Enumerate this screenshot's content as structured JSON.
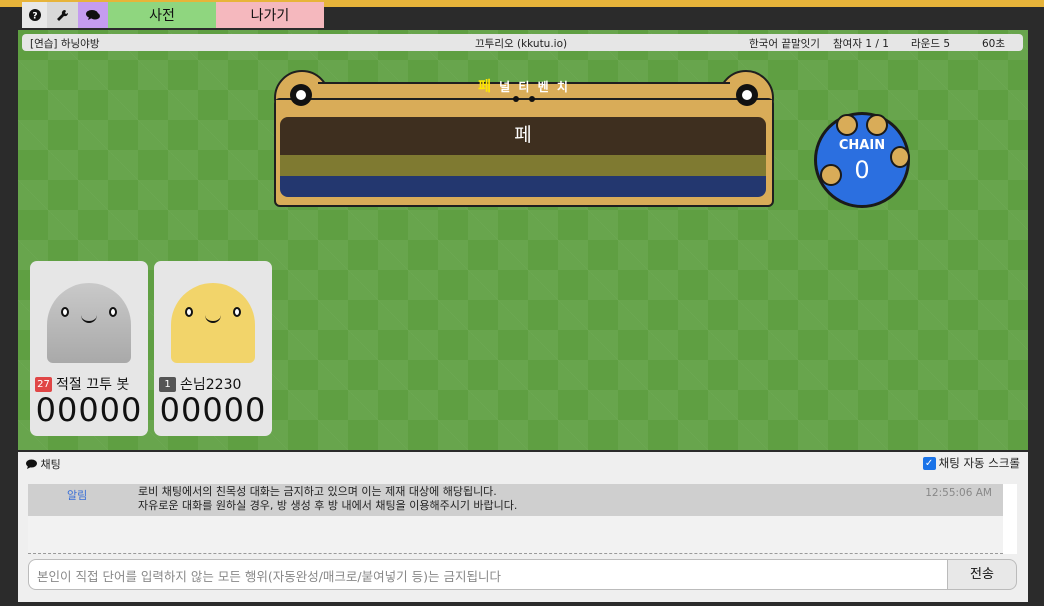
{
  "menu": {
    "dictionary_label": "사전",
    "exit_label": "나가기"
  },
  "room": {
    "name": "[연습] 하닝야방",
    "server": "끄투리오 (kkutu.io)",
    "mode": "한국어 끝말잇기",
    "participants": "참여자 1 / 1",
    "round": "라운드 5",
    "time": "60초"
  },
  "game": {
    "hint_first": "페",
    "hint_rest": " 널 티 벤 치",
    "current_word": "페",
    "chain_label": "CHAIN",
    "chain_value": "0"
  },
  "players": [
    {
      "level": "27",
      "name": "적절 끄투 봇",
      "score": "00000",
      "level_color": "#e04646"
    },
    {
      "level": "1",
      "name": "손님2230",
      "score": "00000",
      "level_color": "#555555"
    }
  ],
  "chat": {
    "title": "채팅",
    "autoscroll_label": "채팅 자동 스크롤",
    "autoscroll_checked": true,
    "messages": [
      {
        "sender": "알림",
        "line1": "로비 채팅에서의 친목성 대화는 금지하고 있으며 이는 제재 대상에 해당됩니다.",
        "line2": "자유로운 대화를 원하실 경우, 방 생성 후 방 내에서 채팅을 이용해주시기 바랍니다.",
        "time": "12:55:06 AM"
      }
    ],
    "input_placeholder": "본인이 직접 단어를 입력하지 않는 모든 행위(자동완성/매크로/붙여넣기 등)는 금지됩니다",
    "send_label": "전송"
  },
  "colors": {
    "accent": "#e7b43a",
    "board": "#d9ac58",
    "field": "#5f9f42",
    "chain": "#2b6fe0"
  },
  "icons": [
    "help-icon",
    "wrench-icon",
    "chat-icon"
  ]
}
